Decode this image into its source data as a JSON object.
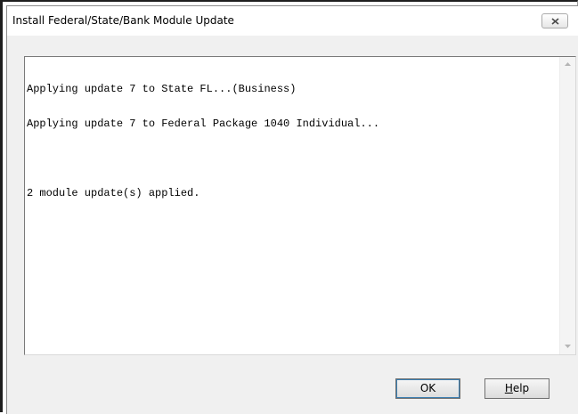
{
  "window": {
    "title": "Install Federal/State/Bank Module Update"
  },
  "log": {
    "lines": [
      "Applying update 7 to State FL...(Business)",
      "Applying update 7 to Federal Package 1040 Individual...",
      "",
      "2 module update(s) applied."
    ]
  },
  "buttons": {
    "ok_label": "OK",
    "help_mnemonic": "H",
    "help_rest": "elp"
  },
  "icons": {
    "close": "close-icon",
    "scroll_up": "arrow-up-icon",
    "scroll_down": "arrow-down-icon"
  }
}
